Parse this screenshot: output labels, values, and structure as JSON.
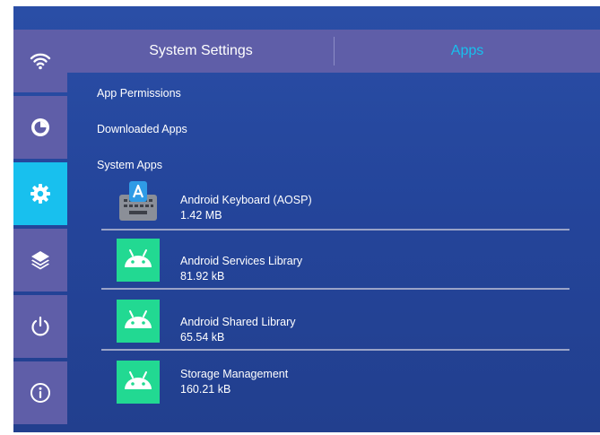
{
  "header": {
    "tab_system": "System Settings",
    "tab_apps": "Apps"
  },
  "colors": {
    "accent": "#18c0ee",
    "rail": "#5f5ea8",
    "android": "#22d992"
  },
  "rail": {
    "items": [
      {
        "icon": "wifi-icon",
        "active": false
      },
      {
        "icon": "pie-chart-icon",
        "active": false
      },
      {
        "icon": "gear-icon",
        "active": true
      },
      {
        "icon": "layers-icon",
        "active": false
      },
      {
        "icon": "power-icon",
        "active": false
      },
      {
        "icon": "info-icon",
        "active": false
      }
    ]
  },
  "menu": {
    "permissions": "App Permissions",
    "downloaded": "Downloaded Apps",
    "system": "System Apps"
  },
  "apps": [
    {
      "name": "Android Keyboard (AOSP)",
      "size": "1.42 MB",
      "icon": "keyboard-icon"
    },
    {
      "name": "Android Services Library",
      "size": "81.92 kB",
      "icon": "android-icon"
    },
    {
      "name": "Android Shared Library",
      "size": "65.54 kB",
      "icon": "android-icon"
    },
    {
      "name": "Storage Management",
      "size": "160.21 kB",
      "icon": "android-icon"
    }
  ]
}
